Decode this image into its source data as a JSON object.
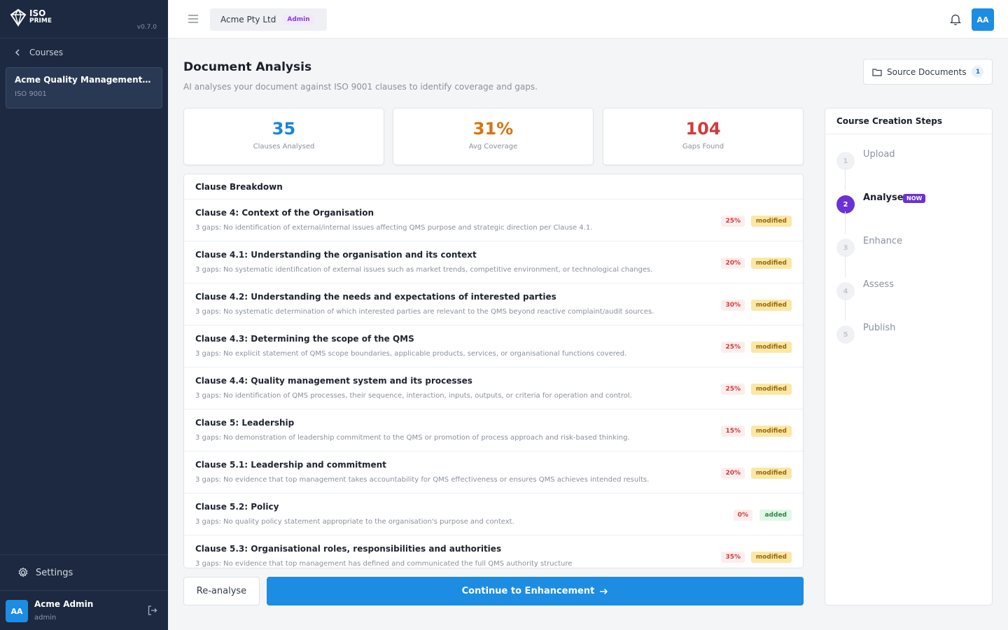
{
  "sidebar": {
    "logo_line1": "ISO",
    "logo_line2": "PRIME",
    "version": "v0.7.0",
    "back_label": "Courses",
    "course": {
      "title": "Acme Quality Management Man...",
      "standard": "ISO 9001"
    },
    "settings_label": "Settings",
    "user": {
      "initials": "AA",
      "name": "Acme Admin",
      "role": "admin"
    }
  },
  "topbar": {
    "org_name": "Acme Pty Ltd",
    "org_badge": "Admin",
    "avatar_initials": "AA"
  },
  "page": {
    "title": "Document Analysis",
    "subtitle": "AI analyses your document against ISO 9001 clauses to identify coverage and gaps.",
    "source_docs_label": "Source Documents",
    "source_docs_count": "1"
  },
  "stats": [
    {
      "value": "35",
      "label": "Clauses Analysed",
      "color": "#1a86d6"
    },
    {
      "value": "31%",
      "label": "Avg Coverage",
      "color": "#d9730f"
    },
    {
      "value": "104",
      "label": "Gaps Found",
      "color": "#d23a3a"
    }
  ],
  "breakdown": {
    "title": "Clause Breakdown",
    "clauses": [
      {
        "name": "Clause 4: Context of the Organisation",
        "desc": "3 gaps: No identification of external/internal issues affecting QMS purpose and strategic direction per Clause 4.1.",
        "pct": "25%",
        "status": "modified"
      },
      {
        "name": "Clause 4.1: Understanding the organisation and its context",
        "desc": "3 gaps: No systematic identification of external issues such as market trends, competitive environment, or technological changes.",
        "pct": "20%",
        "status": "modified"
      },
      {
        "name": "Clause 4.2: Understanding the needs and expectations of interested parties",
        "desc": "3 gaps: No systematic determination of which interested parties are relevant to the QMS beyond reactive complaint/audit sources.",
        "pct": "30%",
        "status": "modified"
      },
      {
        "name": "Clause 4.3: Determining the scope of the QMS",
        "desc": "3 gaps: No explicit statement of QMS scope boundaries, applicable products, services, or organisational functions covered.",
        "pct": "25%",
        "status": "modified"
      },
      {
        "name": "Clause 4.4: Quality management system and its processes",
        "desc": "3 gaps: No identification of QMS processes, their sequence, interaction, inputs, outputs, or criteria for operation and control.",
        "pct": "25%",
        "status": "modified"
      },
      {
        "name": "Clause 5: Leadership",
        "desc": "3 gaps: No demonstration of leadership commitment to the QMS or promotion of process approach and risk-based thinking.",
        "pct": "15%",
        "status": "modified"
      },
      {
        "name": "Clause 5.1: Leadership and commitment",
        "desc": "3 gaps: No evidence that top management takes accountability for QMS effectiveness or ensures QMS achieves intended results.",
        "pct": "20%",
        "status": "modified"
      },
      {
        "name": "Clause 5.2: Policy",
        "desc": "3 gaps: No quality policy statement appropriate to the organisation's purpose and context.",
        "pct": "0%",
        "status": "added"
      },
      {
        "name": "Clause 5.3: Organisational roles, responsibilities and authorities",
        "desc": "3 gaps: No evidence that top management has defined and communicated the full QMS authority structure",
        "pct": "35%",
        "status": "modified"
      }
    ]
  },
  "actions": {
    "reanalyse": "Re-analyse",
    "continue": "Continue to Enhancement"
  },
  "steps": {
    "title": "Course Creation Steps",
    "items": [
      {
        "num": "1",
        "label": "Upload",
        "active": false
      },
      {
        "num": "2",
        "label": "Analyse",
        "active": true,
        "badge": "NOW"
      },
      {
        "num": "3",
        "label": "Enhance",
        "active": false
      },
      {
        "num": "4",
        "label": "Assess",
        "active": false
      },
      {
        "num": "5",
        "label": "Publish",
        "active": false
      }
    ]
  }
}
